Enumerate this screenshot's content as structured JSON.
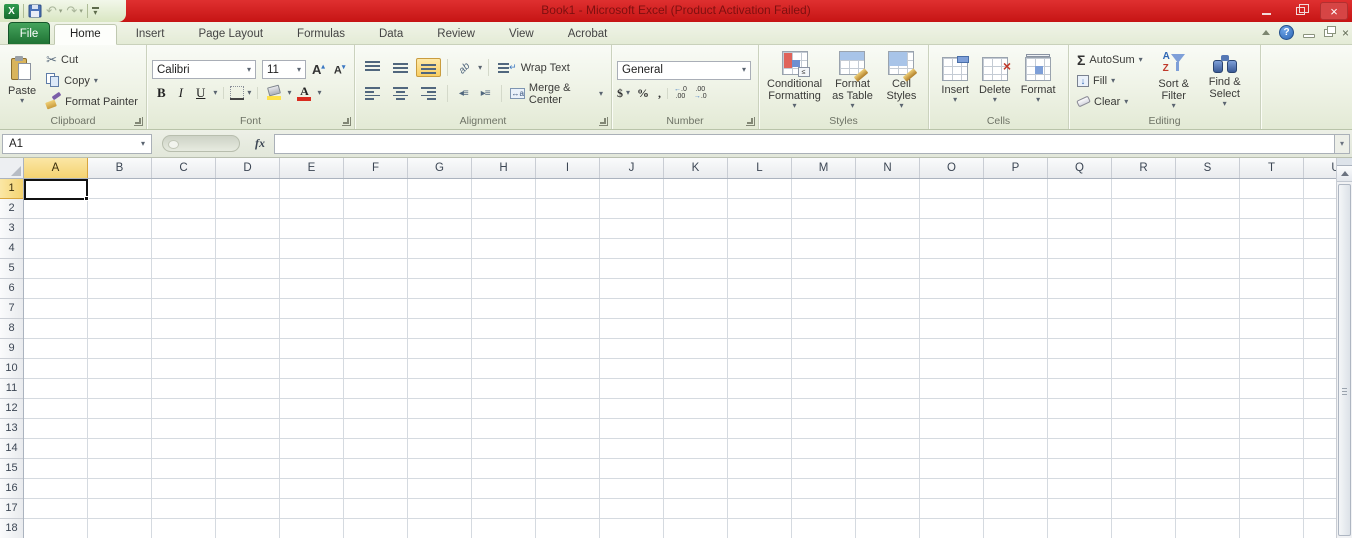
{
  "titlebar": {
    "title": "Book1 - Microsoft Excel (Product Activation Failed)"
  },
  "tabs": {
    "file": "File",
    "items": [
      "Home",
      "Insert",
      "Page Layout",
      "Formulas",
      "Data",
      "Review",
      "View",
      "Acrobat"
    ],
    "active": "Home"
  },
  "ribbon": {
    "clipboard": {
      "label": "Clipboard",
      "paste": "Paste",
      "cut": "Cut",
      "copy": "Copy",
      "format_painter": "Format Painter"
    },
    "font": {
      "label": "Font",
      "font_name": "Calibri",
      "font_size": "11"
    },
    "alignment": {
      "label": "Alignment",
      "wrap_text": "Wrap Text",
      "merge_center": "Merge & Center"
    },
    "number": {
      "label": "Number",
      "format": "General"
    },
    "styles": {
      "label": "Styles",
      "conditional": "Conditional Formatting",
      "format_table": "Format as Table",
      "cell_styles": "Cell Styles"
    },
    "cells": {
      "label": "Cells",
      "insert": "Insert",
      "delete": "Delete",
      "format": "Format"
    },
    "editing": {
      "label": "Editing",
      "autosum": "AutoSum",
      "fill": "Fill",
      "clear": "Clear",
      "sort_filter": "Sort & Filter",
      "find_select": "Find & Select"
    }
  },
  "formula_bar": {
    "name_box": "A1",
    "fx": "fx",
    "formula": ""
  },
  "grid": {
    "columns": [
      "A",
      "B",
      "C",
      "D",
      "E",
      "F",
      "G",
      "H",
      "I",
      "J",
      "K",
      "L",
      "M",
      "N",
      "O",
      "P",
      "Q",
      "R",
      "S",
      "T",
      "U"
    ],
    "rows": [
      "1",
      "2",
      "3",
      "4",
      "5",
      "6",
      "7",
      "8",
      "9",
      "10",
      "11",
      "12",
      "13",
      "14",
      "15",
      "16",
      "17",
      "18"
    ],
    "selected_cell": "A1",
    "selected_column": "A",
    "selected_row": "1"
  },
  "icons": [
    "excel-logo-icon",
    "save-icon",
    "undo-icon",
    "redo-icon",
    "qat-customize-icon",
    "minimize-icon",
    "restore-icon",
    "close-icon",
    "collapse-ribbon-icon",
    "help-icon",
    "paste-icon",
    "cut-icon",
    "copy-icon",
    "format-painter-icon",
    "bold-icon",
    "italic-icon",
    "underline-icon",
    "borders-icon",
    "fill-color-icon",
    "font-color-icon",
    "grow-font-icon",
    "shrink-font-icon",
    "align-top-icon",
    "align-middle-icon",
    "align-bottom-icon",
    "orientation-icon",
    "align-left-icon",
    "align-center-icon",
    "align-right-icon",
    "decrease-indent-icon",
    "increase-indent-icon",
    "wrap-text-icon",
    "merge-center-icon",
    "currency-icon",
    "percent-icon",
    "comma-icon",
    "increase-decimal-icon",
    "decrease-decimal-icon",
    "conditional-formatting-icon",
    "format-as-table-icon",
    "cell-styles-icon",
    "insert-cells-icon",
    "delete-cells-icon",
    "format-cells-icon",
    "autosum-icon",
    "fill-icon",
    "clear-icon",
    "sort-filter-icon",
    "find-select-icon",
    "name-box-dropdown-icon",
    "insert-function-icon",
    "scroll-up-icon",
    "dialog-launcher-icon"
  ],
  "colors": {
    "titlebar_red": "#C61414",
    "titlebar_red_light": "#DF3030",
    "title_text": "#7E1010",
    "file_tab_green": "#1F7234",
    "selected_fill": "#F6D371",
    "grid_line": "#D5DAE0",
    "accent_blue": "#3B78C3"
  }
}
